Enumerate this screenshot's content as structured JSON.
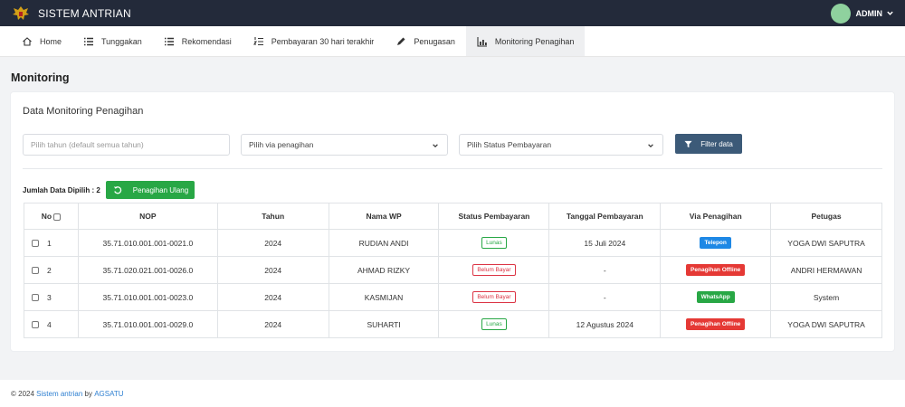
{
  "app": {
    "title": "SISTEM ANTRIAN"
  },
  "user": {
    "label": "ADMIN"
  },
  "nav": [
    {
      "label": "Home",
      "icon": "home-icon"
    },
    {
      "label": "Tunggakan",
      "icon": "list-icon"
    },
    {
      "label": "Rekomendasi",
      "icon": "list-icon"
    },
    {
      "label": "Pembayaran 30 hari terakhir",
      "icon": "ordered-list-icon"
    },
    {
      "label": "Penugasan",
      "icon": "pen-icon"
    },
    {
      "label": "Monitoring Penagihan",
      "icon": "chart-icon",
      "active": true
    }
  ],
  "page": {
    "title": "Monitoring"
  },
  "card": {
    "title": "Data Monitoring Penagihan",
    "year_placeholder": "Pilih tahun (default semua tahun)",
    "via_select": "Pilih via penagihan",
    "status_select": "Pilih Status Pembayaran",
    "filter_label": "Filter data",
    "count_label": "Jumlah Data Dipilih : 2",
    "reask_label": "Penagihan Ulang"
  },
  "table": {
    "headers": [
      "No",
      "NOP",
      "Tahun",
      "Nama WP",
      "Status Pembayaran",
      "Tanggal Pembayaran",
      "Via Penagihan",
      "Petugas"
    ],
    "rows": [
      {
        "no": "1",
        "nop": "35.71.010.001.001-0021.0",
        "tahun": "2024",
        "nama": "RUDIAN ANDI",
        "status": "Lunas",
        "tanggal": "15 Juli 2024",
        "via": "Telepon",
        "petugas": "YOGA DWI SAPUTRA"
      },
      {
        "no": "2",
        "nop": "35.71.020.021.001-0026.0",
        "tahun": "2024",
        "nama": "AHMAD RIZKY",
        "status": "Belum Bayar",
        "tanggal": "-",
        "via": "Penagihan Offline",
        "petugas": "ANDRI HERMAWAN"
      },
      {
        "no": "3",
        "nop": "35.71.010.001.001-0023.0",
        "tahun": "2024",
        "nama": "KASMIJAN",
        "status": "Belum Bayar",
        "tanggal": "-",
        "via": "WhatsApp",
        "petugas": "System"
      },
      {
        "no": "4",
        "nop": "35.71.010.001.001-0029.0",
        "tahun": "2024",
        "nama": "SUHARTI",
        "status": "Lunas",
        "tanggal": "12 Agustus 2024",
        "via": "Penagihan Offline",
        "petugas": "YOGA DWI SAPUTRA"
      }
    ]
  },
  "colors": {
    "topbar": "#232a3a",
    "telepon": "#1e88e5",
    "offline": "#e53935",
    "whatsapp": "#28a745",
    "lunas": "#28a745",
    "belum": "#dc3545"
  },
  "footer": {
    "prefix": "© 2024",
    "link1": "Sistem antrian",
    "middle": "by",
    "link2": "AGSATU"
  }
}
